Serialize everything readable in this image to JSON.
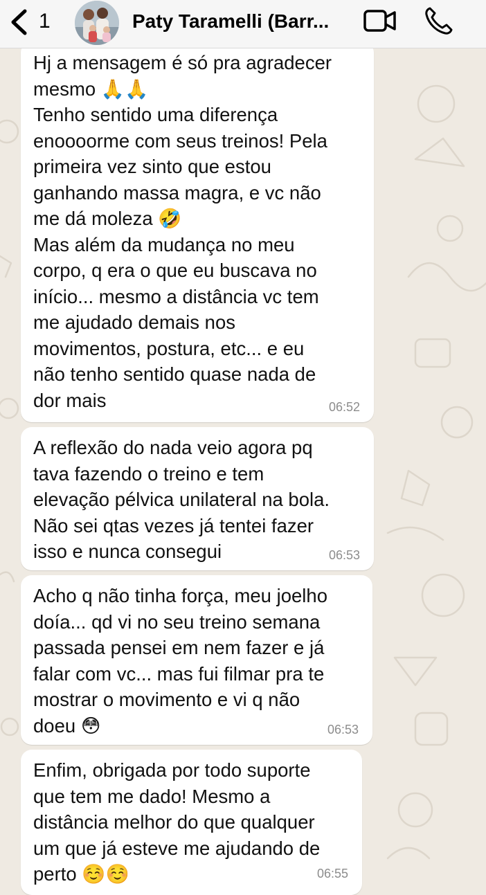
{
  "header": {
    "unread_count": "1",
    "contact_name": "Paty Taramelli (Barr..."
  },
  "messages": [
    {
      "text": "Hj a mensagem é só pra agradecer\nmesmo 🙏🙏\nTenho sentido uma diferença\nenoooorme com seus treinos! Pela\nprimeira vez sinto que estou\nganhando massa magra, e vc não\nme dá moleza 🤣\nMas além da mudança no meu\ncorpo, q era o que eu buscava no\ninício... mesmo a distância vc tem\nme ajudado demais nos\nmovimentos, postura, etc... e eu\nnão tenho sentido quase nada de\ndor mais",
      "time": "06:52"
    },
    {
      "text": "A reflexão do nada veio agora pq\ntava fazendo o treino e tem\nelevação pélvica unilateral na bola.\nNão sei qtas vezes já tentei fazer\nisso e nunca consegui",
      "time": "06:53"
    },
    {
      "text": "Acho q não tinha força, meu joelho\ndoía... qd vi no seu treino semana\npassada pensei em nem fazer e já\nfalar com vc... mas fui filmar pra te\nmostrar o movimento e vi q não\ndoeu 😳",
      "time": "06:53"
    },
    {
      "text": "Enfim, obrigada por todo suporte\nque tem me dado! Mesmo a\ndistância melhor do que qualquer\num que já esteve me ajudando de\nperto ☺️☺️",
      "time": "06:55"
    }
  ],
  "icons": {
    "back": "chevron-left-icon",
    "video": "video-camera-icon",
    "call": "phone-icon"
  },
  "colors": {
    "chat_background": "#efeae2",
    "bubble": "#ffffff",
    "header": "#f6f6f6",
    "timestamp": "#8c8c8c"
  }
}
